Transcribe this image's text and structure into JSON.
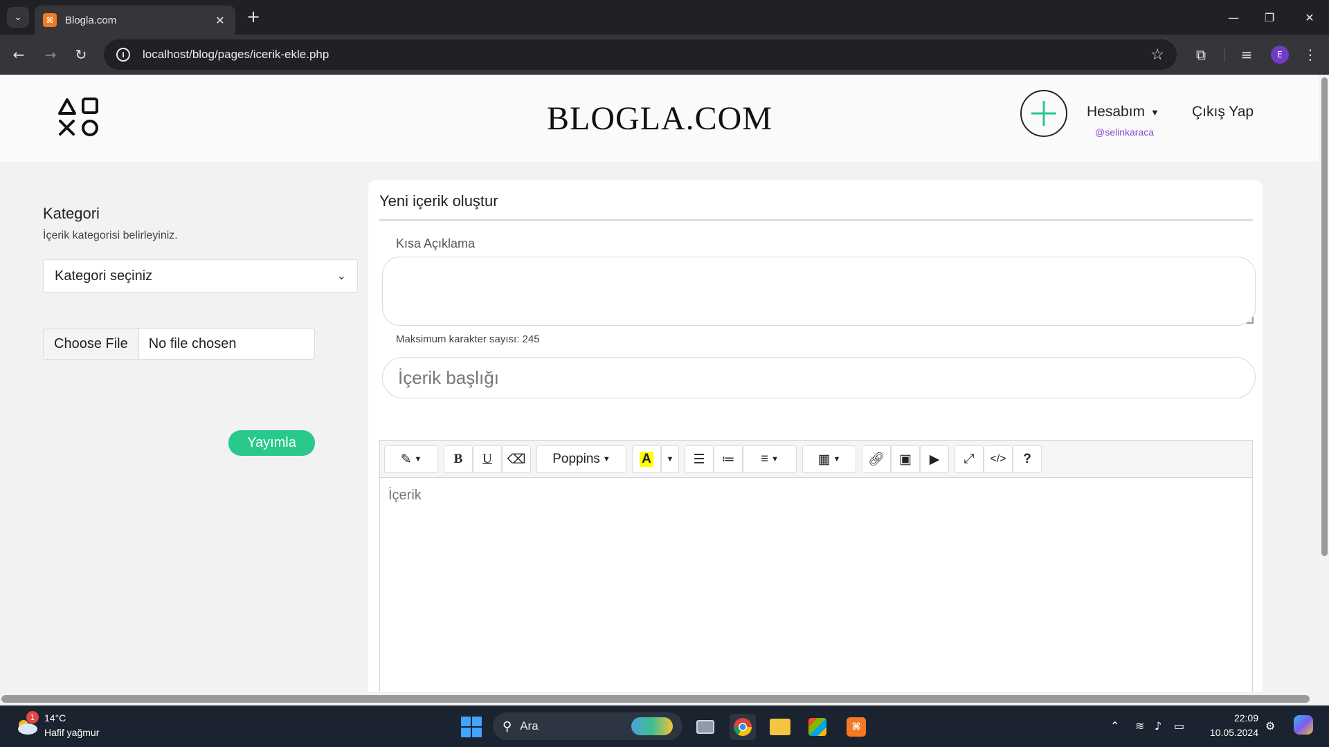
{
  "browser": {
    "tab_title": "Blogla.com",
    "url": "localhost/blog/pages/icerik-ekle.php",
    "profile_initial": "E"
  },
  "site": {
    "brand": "BLOGLA.COM",
    "account_label": "Hesabım",
    "username": "@selinkaraca",
    "logout_label": "Çıkış Yap"
  },
  "sidebar": {
    "category_title": "Kategori",
    "category_subtitle": "İçerik kategorisi belirleyiniz.",
    "category_select_value": "Kategori seçiniz",
    "file_button": "Choose File",
    "file_status": "No file chosen",
    "publish_label": "Yayımla"
  },
  "form": {
    "card_title": "Yeni içerik oluştur",
    "short_desc_label": "Kısa Açıklama",
    "short_desc_value": "",
    "max_chars_note": "Maksimum karakter sayısı: 245",
    "title_placeholder": "İçerik başlığı",
    "content_placeholder": "İçerik"
  },
  "editor_toolbar": {
    "font_name": "Poppins",
    "bold": "B",
    "underline": "U",
    "code": "</>",
    "help": "?"
  },
  "taskbar": {
    "weather_temp": "14°C",
    "weather_desc": "Hafif yağmur",
    "weather_badge": "1",
    "search_label": "Ara",
    "time": "22:09",
    "date": "10.05.2024"
  },
  "colors": {
    "accent_green": "#28c98b",
    "username_purple": "#8a4bd6"
  }
}
